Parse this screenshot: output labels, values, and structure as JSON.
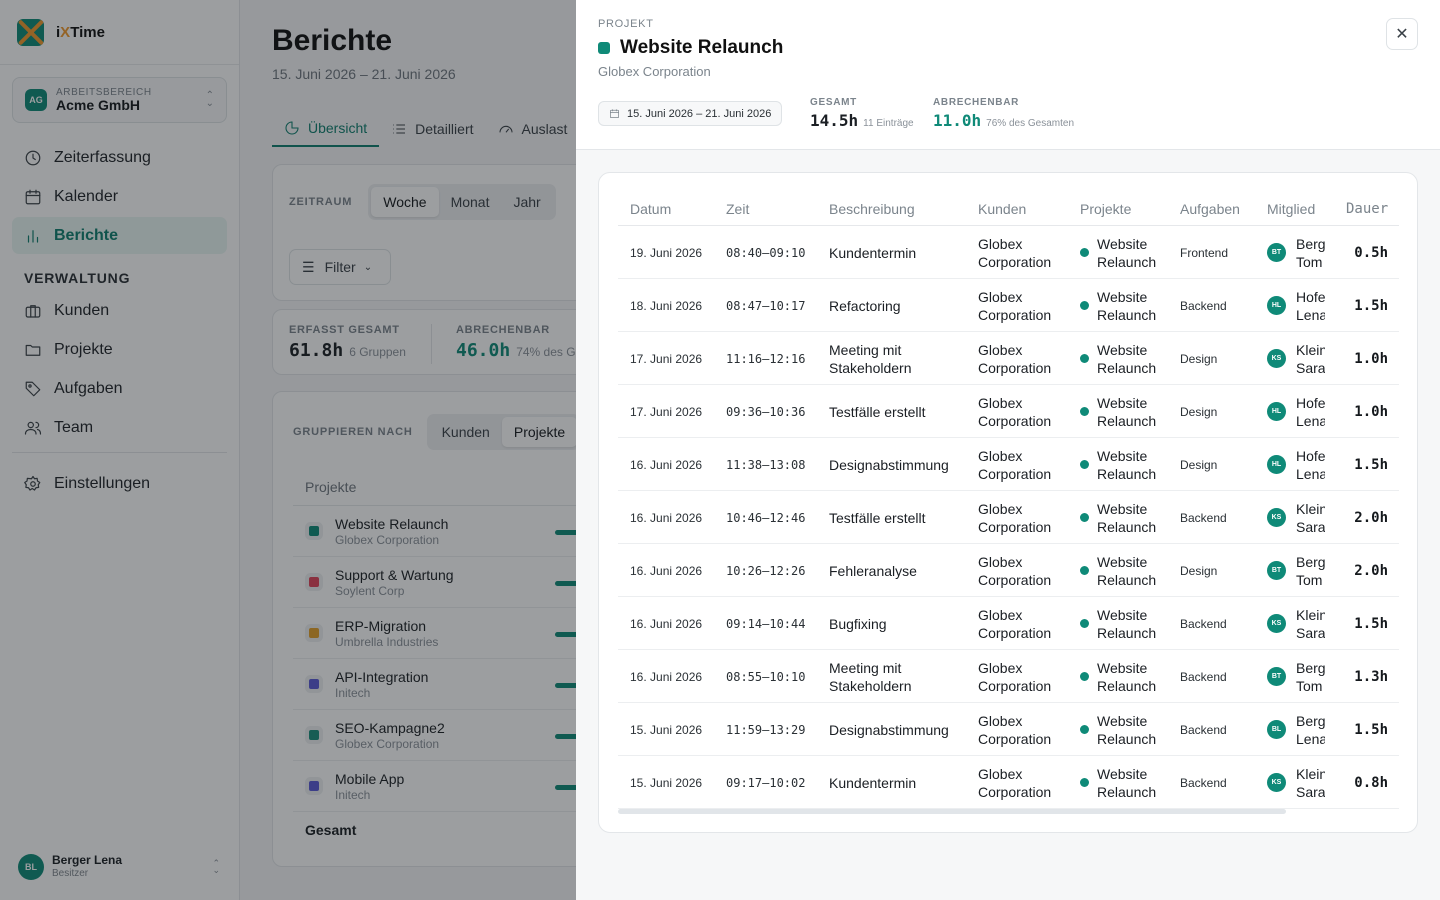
{
  "app": {
    "brand_prefix": "i",
    "brand_x": "X",
    "brand_suffix": "Time"
  },
  "workspace": {
    "badge": "AG",
    "label": "ARBEITSBEREICH",
    "name": "Acme GmbH"
  },
  "nav": {
    "main": [
      {
        "label": "Zeiterfassung",
        "icon": "clock-icon"
      },
      {
        "label": "Kalender",
        "icon": "calendar-icon"
      },
      {
        "label": "Berichte",
        "icon": "bar-chart-icon",
        "active": true
      }
    ],
    "section_label": "VERWALTUNG",
    "admin": [
      {
        "label": "Kunden",
        "icon": "briefcase-icon"
      },
      {
        "label": "Projekte",
        "icon": "folder-icon"
      },
      {
        "label": "Aufgaben",
        "icon": "tag-icon"
      },
      {
        "label": "Team",
        "icon": "users-icon"
      }
    ],
    "settings": "Einstellungen"
  },
  "user": {
    "initials": "BL",
    "name": "Berger Lena",
    "role": "Besitzer"
  },
  "main": {
    "title": "Berichte",
    "subtitle": "15. Juni 2026 – 21. Juni 2026",
    "tabs": [
      "Übersicht",
      "Detailliert",
      "Auslast"
    ],
    "period": {
      "label": "ZEITRAUM",
      "options": [
        "Woche",
        "Monat",
        "Jahr"
      ]
    },
    "filter": "Filter",
    "stats": [
      {
        "label": "ERFASST GESAMT",
        "value": "61.8h",
        "note": "6 Gruppen"
      },
      {
        "label": "ABRECHENBAR",
        "value": "46.0h",
        "note": "74% des G"
      }
    ],
    "group": {
      "label": "GRUPPIEREN NACH",
      "options": [
        "Kunden",
        "Projekte"
      ]
    },
    "projects_header": "Projekte",
    "projects": [
      {
        "name": "Website Relaunch",
        "client": "Globex Corporation",
        "color": "#0f8a78"
      },
      {
        "name": "Support & Wartung",
        "client": "Soylent Corp",
        "color": "#e0445b"
      },
      {
        "name": "ERP-Migration",
        "client": "Umbrella Industries",
        "color": "#e3a12a"
      },
      {
        "name": "API-Integration",
        "client": "Initech",
        "color": "#5b5bd6"
      },
      {
        "name": "SEO-Kampagne2",
        "client": "Globex Corporation",
        "color": "#1a8f7d"
      },
      {
        "name": "Mobile App",
        "client": "Initech",
        "color": "#5b5bd6"
      }
    ],
    "total": "Gesamt"
  },
  "panel": {
    "label": "PROJEKT",
    "title": "Website Relaunch",
    "client": "Globex Corporation",
    "date_range": "15. Juni 2026 – 21. Juni 2026",
    "total": {
      "label": "GESAMT",
      "value": "14.5h",
      "note": "11 Einträge"
    },
    "billable": {
      "label": "ABRECHENBAR",
      "value": "11.0h",
      "note": "76% des Gesamten"
    },
    "columns": [
      "Datum",
      "Zeit",
      "Beschreibung",
      "Kunden",
      "Projekte",
      "Aufgaben",
      "Mitglied",
      "Dauer"
    ],
    "rows": [
      {
        "date": "19. Juni 2026",
        "time": "08:40–09:10",
        "desc": "Kundentermin",
        "client": "Globex Corporation",
        "project": "Website Relaunch",
        "task": "Frontend",
        "initials": "BT",
        "member": "Berger Tom",
        "dur": "0.5h"
      },
      {
        "date": "18. Juni 2026",
        "time": "08:47–10:17",
        "desc": "Refactoring",
        "client": "Globex Corporation",
        "project": "Website Relaunch",
        "task": "Backend",
        "initials": "HL",
        "member": "Hofer Lena",
        "dur": "1.5h"
      },
      {
        "date": "17. Juni 2026",
        "time": "11:16–12:16",
        "desc": "Meeting mit Stakeholdern",
        "client": "Globex Corporation",
        "project": "Website Relaunch",
        "task": "Design",
        "initials": "KS",
        "member": "Klein Sara",
        "dur": "1.0h"
      },
      {
        "date": "17. Juni 2026",
        "time": "09:36–10:36",
        "desc": "Testfälle erstellt",
        "client": "Globex Corporation",
        "project": "Website Relaunch",
        "task": "Design",
        "initials": "HL",
        "member": "Hofer Lena",
        "dur": "1.0h"
      },
      {
        "date": "16. Juni 2026",
        "time": "11:38–13:08",
        "desc": "Designabstimmung",
        "client": "Globex Corporation",
        "project": "Website Relaunch",
        "task": "Design",
        "initials": "HL",
        "member": "Hofer Lena",
        "dur": "1.5h"
      },
      {
        "date": "16. Juni 2026",
        "time": "10:46–12:46",
        "desc": "Testfälle erstellt",
        "client": "Globex Corporation",
        "project": "Website Relaunch",
        "task": "Backend",
        "initials": "KS",
        "member": "Klein Sara",
        "dur": "2.0h"
      },
      {
        "date": "16. Juni 2026",
        "time": "10:26–12:26",
        "desc": "Fehleranalyse",
        "client": "Globex Corporation",
        "project": "Website Relaunch",
        "task": "Design",
        "initials": "BT",
        "member": "Berger Tom",
        "dur": "2.0h"
      },
      {
        "date": "16. Juni 2026",
        "time": "09:14–10:44",
        "desc": "Bugfixing",
        "client": "Globex Corporation",
        "project": "Website Relaunch",
        "task": "Backend",
        "initials": "KS",
        "member": "Klein Sara",
        "dur": "1.5h"
      },
      {
        "date": "16. Juni 2026",
        "time": "08:55–10:10",
        "desc": "Meeting mit Stakeholdern",
        "client": "Globex Corporation",
        "project": "Website Relaunch",
        "task": "Backend",
        "initials": "BT",
        "member": "Berger Tom",
        "dur": "1.3h"
      },
      {
        "date": "15. Juni 2026",
        "time": "11:59–13:29",
        "desc": "Designabstimmung",
        "client": "Globex Corporation",
        "project": "Website Relaunch",
        "task": "Backend",
        "initials": "BL",
        "member": "Berger Lena",
        "dur": "1.5h"
      },
      {
        "date": "15. Juni 2026",
        "time": "09:17–10:02",
        "desc": "Kundentermin",
        "client": "Globex Corporation",
        "project": "Website Relaunch",
        "task": "Backend",
        "initials": "KS",
        "member": "Klein Sara",
        "dur": "0.8h"
      }
    ]
  },
  "colors": {
    "accent": "#0f8a78",
    "brand_orange": "#f29a2e"
  }
}
